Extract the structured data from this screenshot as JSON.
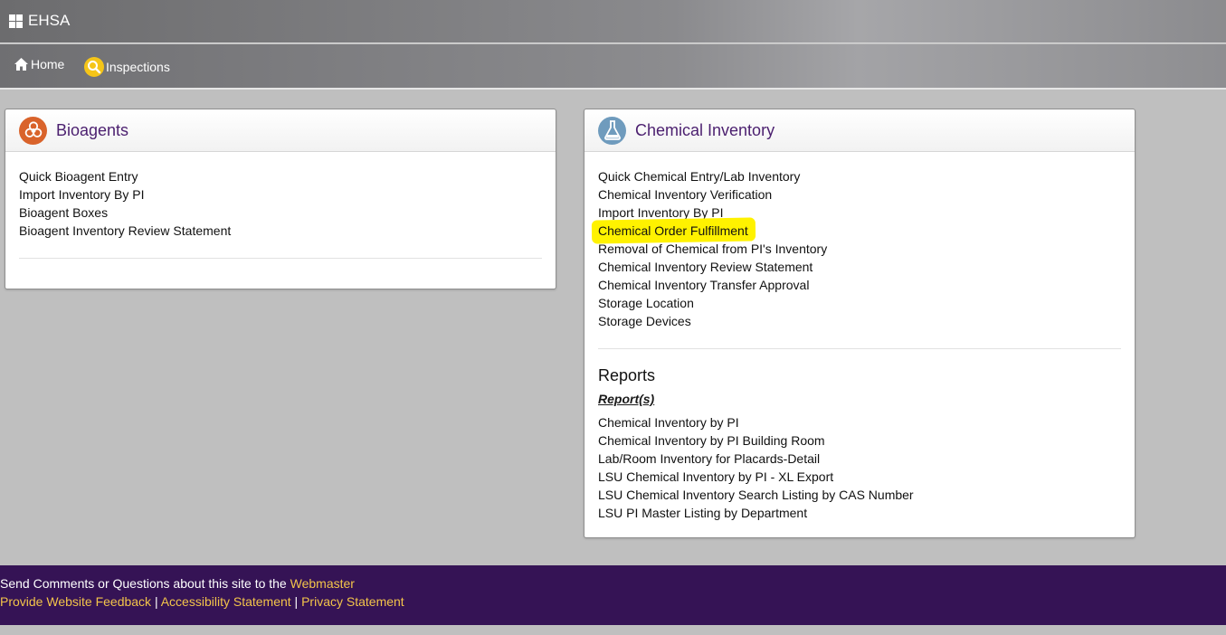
{
  "app": {
    "title": "EHSA"
  },
  "nav": {
    "home": "Home",
    "inspections": "Inspections"
  },
  "bio": {
    "title": "Bioagents",
    "links": [
      "Quick Bioagent Entry",
      "Import Inventory By PI",
      "Bioagent Boxes",
      "Bioagent Inventory Review Statement"
    ]
  },
  "chem": {
    "title": "Chemical Inventory",
    "links": [
      "Quick Chemical Entry/Lab Inventory",
      "Chemical Inventory Verification",
      "Import Inventory By PI",
      "Chemical Order Fulfillment",
      "Removal of Chemical from PI's Inventory",
      "Chemical Inventory Review Statement",
      "Chemical Inventory Transfer Approval",
      "Storage Location",
      "Storage Devices"
    ],
    "reports_heading": "Reports",
    "reports_sub": "Report(s)",
    "reports": [
      "Chemical Inventory by PI",
      "Chemical Inventory by PI Building Room",
      "Lab/Room Inventory for Placards-Detail",
      "LSU Chemical Inventory by PI - XL Export",
      "LSU Chemical Inventory Search Listing by CAS Number",
      "LSU PI Master Listing by Department"
    ]
  },
  "footer": {
    "line1_text": "Send Comments or Questions about this site to the ",
    "webmaster": "Webmaster",
    "feedback": "Provide Website Feedback",
    "sep": " | ",
    "accessibility": "Accessibility Statement",
    "privacy": "Privacy Statement"
  },
  "colors": {
    "accent_purple": "#4b1f6f",
    "footer_bg": "#351355",
    "footer_link": "#f3c44a",
    "highlight": "#fff200"
  }
}
